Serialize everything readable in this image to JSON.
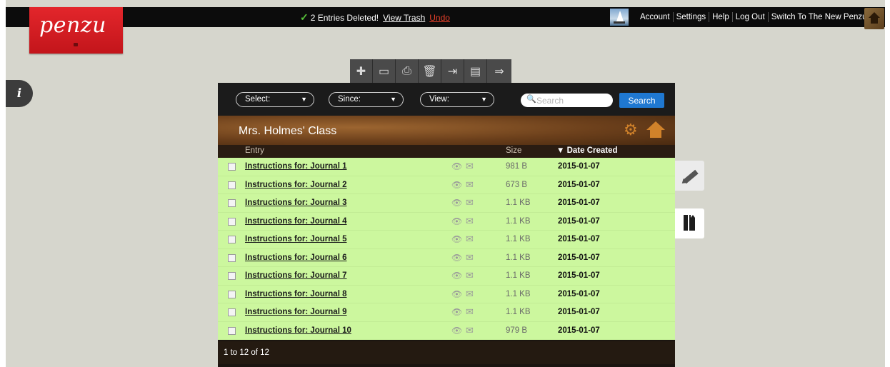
{
  "topbar": {
    "notice_text": "2 Entries Deleted!",
    "view_trash": "View Trash",
    "undo": "Undo",
    "nav": [
      "Account",
      "Settings",
      "Help",
      "Log Out",
      "Switch To The New Penzu"
    ]
  },
  "logo": {
    "text": "penzu"
  },
  "info_tab": {
    "label": "i"
  },
  "toolbar": {
    "icons": [
      "add-icon",
      "folder-icon",
      "print-icon",
      "trash-icon",
      "move-icon",
      "clipboard-icon",
      "export-icon"
    ],
    "glyphs": [
      "✚",
      "▭",
      "⎙",
      "🗑",
      "⇥",
      "▤",
      "⇒"
    ]
  },
  "filters": {
    "select": "Select:",
    "since": "Since:",
    "view": "View:",
    "search_placeholder": "Search",
    "search_button": "Search"
  },
  "journal": {
    "title": "Mrs. Holmes' Class"
  },
  "table": {
    "columns": {
      "entry": "Entry",
      "size": "Size",
      "date": "▼ Date Created"
    },
    "rows": [
      {
        "name": "Instructions for: Journal 1",
        "size": "981 B",
        "date": "2015-01-07"
      },
      {
        "name": "Instructions for: Journal 2",
        "size": "673 B",
        "date": "2015-01-07"
      },
      {
        "name": "Instructions for: Journal 3",
        "size": "1.1 KB",
        "date": "2015-01-07"
      },
      {
        "name": "Instructions for: Journal 4",
        "size": "1.1 KB",
        "date": "2015-01-07"
      },
      {
        "name": "Instructions for: Journal 5",
        "size": "1.1 KB",
        "date": "2015-01-07"
      },
      {
        "name": "Instructions for: Journal 6",
        "size": "1.1 KB",
        "date": "2015-01-07"
      },
      {
        "name": "Instructions for: Journal 7",
        "size": "1.1 KB",
        "date": "2015-01-07"
      },
      {
        "name": "Instructions for: Journal 8",
        "size": "1.1 KB",
        "date": "2015-01-07"
      },
      {
        "name": "Instructions for: Journal 9",
        "size": "1.1 KB",
        "date": "2015-01-07"
      },
      {
        "name": "Instructions for: Journal 10",
        "size": "979 B",
        "date": "2015-01-07"
      }
    ]
  },
  "pager": {
    "text": "1 to 12 of 12"
  },
  "colors": {
    "row_bg": "#ccf79e",
    "logo_red": "#d41d22",
    "search_blue": "#1f78d1",
    "accent_orange": "#d1822a"
  }
}
